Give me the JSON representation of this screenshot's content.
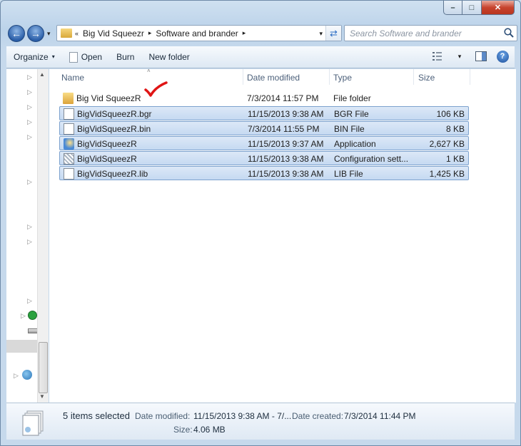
{
  "window": {
    "caption": {
      "minimize": "–",
      "maximize": "□",
      "close": "✕"
    }
  },
  "nav": {
    "back_icon": "←",
    "forward_icon": "→",
    "dropdown_icon": "▾",
    "breadcrumb_overflow": "«",
    "breadcrumb": [
      "Big Vid Squeezr",
      "Software and brander"
    ],
    "breadcrumb_sep": "▸",
    "address_dropdown_icon": "▾",
    "refresh_icon": "⇄",
    "search_placeholder": "Search Software and brander"
  },
  "toolbar": {
    "organize": "Organize",
    "open": "Open",
    "burn": "Burn",
    "new_folder": "New folder",
    "dropdown_icon": "▾",
    "help": "?"
  },
  "columns": {
    "name": "Name",
    "date_modified": "Date modified",
    "type": "Type",
    "size": "Size",
    "sort_indicator": "˄"
  },
  "files": [
    {
      "name": "Big Vid SqueezR",
      "date": "7/3/2014 11:57 PM",
      "type": "File folder",
      "size": "",
      "icon": "folder-icon",
      "selected": false
    },
    {
      "name": "BigVidSqueezR.bgr",
      "date": "11/15/2013 9:38 AM",
      "type": "BGR File",
      "size": "106 KB",
      "icon": "file-icon",
      "selected": true
    },
    {
      "name": "BigVidSqueezR.bin",
      "date": "7/3/2014 11:55 PM",
      "type": "BIN File",
      "size": "8 KB",
      "icon": "file-icon",
      "selected": true
    },
    {
      "name": "BigVidSqueezR",
      "date": "11/15/2013 9:37 AM",
      "type": "Application",
      "size": "2,627 KB",
      "icon": "application-icon",
      "selected": true
    },
    {
      "name": "BigVidSqueezR",
      "date": "11/15/2013 9:38 AM",
      "type": "Configuration sett...",
      "size": "1 KB",
      "icon": "config-file-icon",
      "selected": true
    },
    {
      "name": "BigVidSqueezR.lib",
      "date": "11/15/2013 9:38 AM",
      "type": "LIB File",
      "size": "1,425 KB",
      "icon": "file-icon",
      "selected": true
    }
  ],
  "annotation": {
    "check_color": "#e01515"
  },
  "details": {
    "summary": "5 items selected",
    "date_modified_label": "Date modified:",
    "date_modified_value": "11/15/2013 9:38 AM - 7/...",
    "date_created_label": "Date created:",
    "date_created_value": "7/3/2014 11:44 PM",
    "size_label": "Size:",
    "size_value": "4.06 MB"
  },
  "navpane": {
    "expand_arrow": "▷",
    "scroll_up": "▲",
    "scroll_down": "▼"
  }
}
